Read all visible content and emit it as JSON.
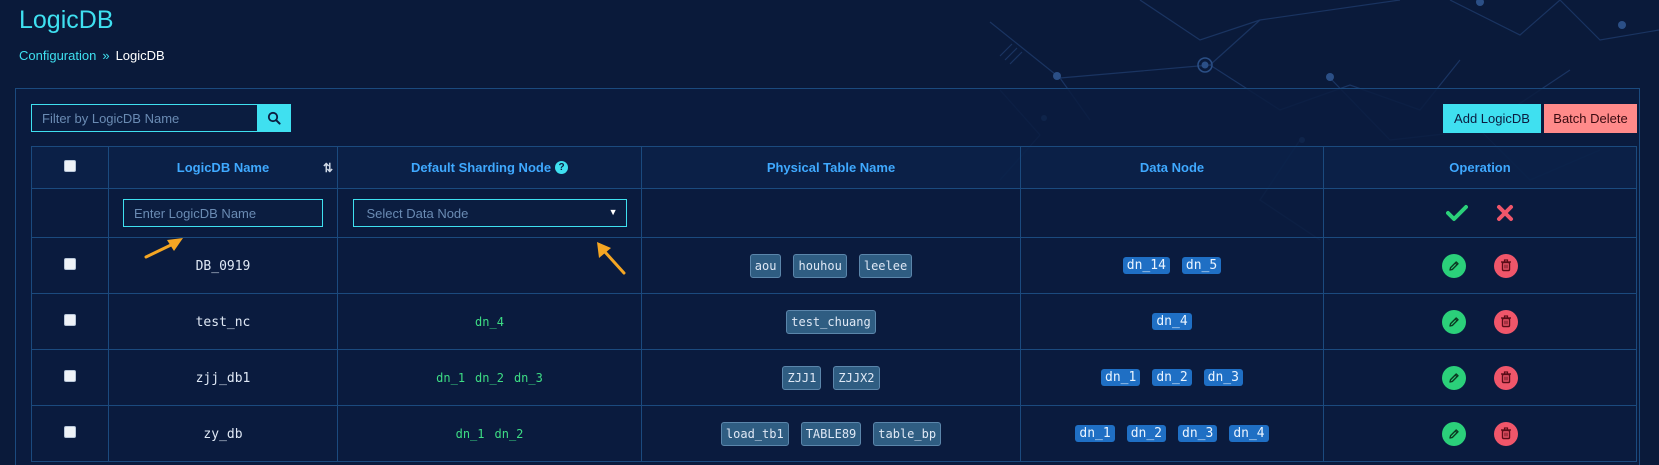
{
  "page": {
    "title": "LogicDB",
    "breadcrumb": {
      "parent": "Configuration",
      "separator": "»",
      "current": "LogicDB"
    }
  },
  "toolbar": {
    "search_placeholder": "Filter by LogicDB Name",
    "add_label": "Add LogicDB",
    "batch_delete_label": "Batch Delete"
  },
  "table": {
    "columns": {
      "name": "LogicDB Name",
      "default_node": "Default Sharding Node",
      "physical_tables": "Physical Table Name",
      "data_nodes": "Data Node",
      "operation": "Operation"
    },
    "new_row": {
      "name_placeholder": "Enter LogicDB Name",
      "node_placeholder": "Select Data Node"
    },
    "rows": [
      {
        "name": "DB_0919",
        "default_nodes": [],
        "physical_tables": [
          "aou",
          "houhou",
          "leelee"
        ],
        "data_nodes": [
          "dn_14",
          "dn_5"
        ]
      },
      {
        "name": "test_nc",
        "default_nodes": [
          "dn_4"
        ],
        "physical_tables": [
          "test_chuang"
        ],
        "data_nodes": [
          "dn_4"
        ]
      },
      {
        "name": "zjj_db1",
        "default_nodes": [
          "dn_1",
          "dn_2",
          "dn_3"
        ],
        "physical_tables": [
          "ZJJ1",
          "ZJJX2"
        ],
        "data_nodes": [
          "dn_1",
          "dn_2",
          "dn_3"
        ]
      },
      {
        "name": "zy_db",
        "default_nodes": [
          "dn_1",
          "dn_2"
        ],
        "physical_tables": [
          "load_tb1",
          "TABLE89",
          "table_bp"
        ],
        "data_nodes": [
          "dn_1",
          "dn_2",
          "dn_3",
          "dn_4"
        ]
      }
    ]
  },
  "icons": {
    "search": "search-icon",
    "sort": "sort-icon",
    "help": "help-icon",
    "confirm": "check-icon",
    "cancel": "close-icon",
    "edit": "pencil-icon",
    "delete": "trash-icon",
    "annotation": "arrow-pointer-icon"
  },
  "colors": {
    "accent": "#3fe0f0",
    "header_text": "#3fa9ff",
    "confirm": "#2bd07a",
    "danger": "#f0566a",
    "batch_delete": "#ff8a8a",
    "background": "#0a1a3a",
    "annotation_arrow": "#f5a623"
  }
}
